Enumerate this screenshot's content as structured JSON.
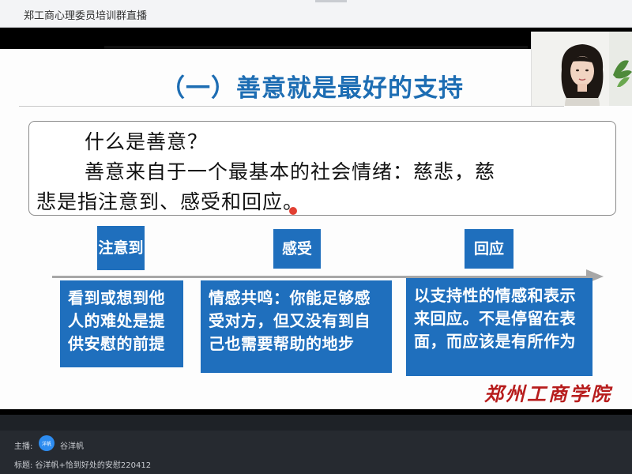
{
  "window": {
    "title": "郑工商心理委员培训群直播"
  },
  "slide": {
    "headline": "（一）善意就是最好的支持",
    "question": "什么是善意？",
    "line1": "善意来自于一个最基本的社会情绪：慈悲，慈",
    "line2": "悲是指注意到、感受和回应。",
    "stages": [
      {
        "label": "注意到",
        "description": "看到或想到他人的难处是提供安慰的前提"
      },
      {
        "label": "感受",
        "description": "情感共鸣：你能足够感受对方，但又没有到自己也需要帮助的地步"
      },
      {
        "label": "回应",
        "description": "以支持性的情感和表示来回应。不是停留在表面，而应该是有所作为"
      }
    ],
    "watermark": "郑州工商学院"
  },
  "live": {
    "host_label": "主播:",
    "avatar_text": "洋帆",
    "host_name": "谷洋帆",
    "subject": "标题: 谷洋帆+恰到好处的安慰220412"
  },
  "colors": {
    "accent": "#1f6fbd",
    "headline": "#1d6db3",
    "watermark": "#b71c1c"
  }
}
